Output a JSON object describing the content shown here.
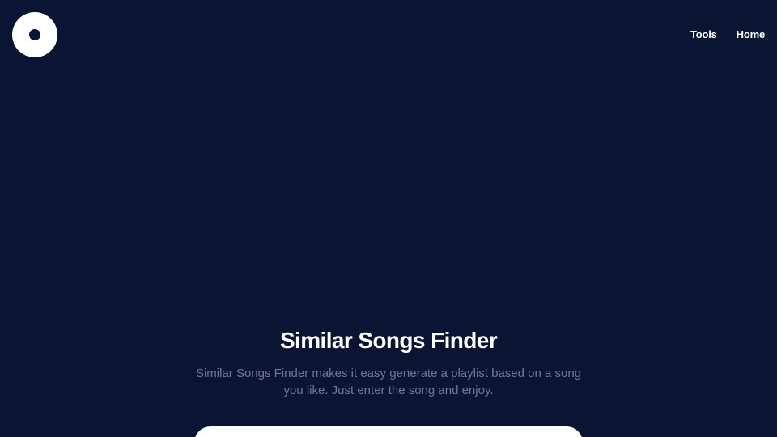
{
  "header": {
    "logo_icon": "vinyl-disc-icon",
    "nav": [
      {
        "label": "Tools"
      },
      {
        "label": "Home"
      }
    ]
  },
  "hero": {
    "title": "Similar Songs Finder",
    "description": "Similar Songs Finder makes it easy generate a playlist based on a song you like. Just enter the song and enjoy."
  },
  "search": {
    "placeholder": ""
  },
  "colors": {
    "background": "#0b1533",
    "text": "#ffffff",
    "muted": "#6b7a99"
  }
}
